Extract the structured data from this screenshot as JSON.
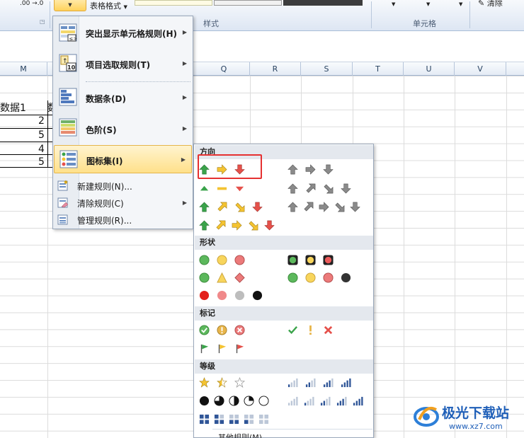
{
  "ribbon": {
    "number_format_label": ".00 →.0",
    "table_format_label": "表格格式",
    "style_group_label": "样式",
    "cells_group_label": "单元格",
    "clear_label": "清除",
    "dropdown_arrow": "▼"
  },
  "columns": {
    "m": "M",
    "q": "Q",
    "r": "R",
    "s": "S",
    "t": "T",
    "u": "U",
    "v": "V"
  },
  "cells": {
    "header": "数据1",
    "header_cut": "数",
    "values": [
      "2",
      "5",
      "4",
      "5"
    ]
  },
  "menu": {
    "items": [
      {
        "label": "突出显示单元格规则(H)",
        "icon": "highlight-rules-icon"
      },
      {
        "label": "项目选取规则(T)",
        "icon": "top-bottom-rules-icon"
      },
      {
        "label": "数据条(D)",
        "icon": "data-bars-icon"
      },
      {
        "label": "色阶(S)",
        "icon": "color-scales-icon"
      },
      {
        "label": "图标集(I)",
        "icon": "icon-sets-icon"
      }
    ],
    "small_items": [
      {
        "label": "新建规则(N)...",
        "icon": "new-rule-icon"
      },
      {
        "label": "清除规则(C)",
        "icon": "clear-rules-icon"
      },
      {
        "label": "管理规则(R)...",
        "icon": "manage-rules-icon"
      }
    ],
    "arrow": "▶"
  },
  "submenu": {
    "sections": {
      "directional": "方向",
      "shapes": "形状",
      "indicators": "标记",
      "ratings": "等级"
    },
    "more_rules": "其他规则(M)..."
  },
  "watermark": {
    "name": "极光下载站",
    "url": "www.xz7.com"
  },
  "colors": {
    "green": "#3aa34a",
    "yellow": "#f4c331",
    "red": "#e5504a",
    "gray": "#8a8a8a",
    "highlight": "#e53131"
  }
}
